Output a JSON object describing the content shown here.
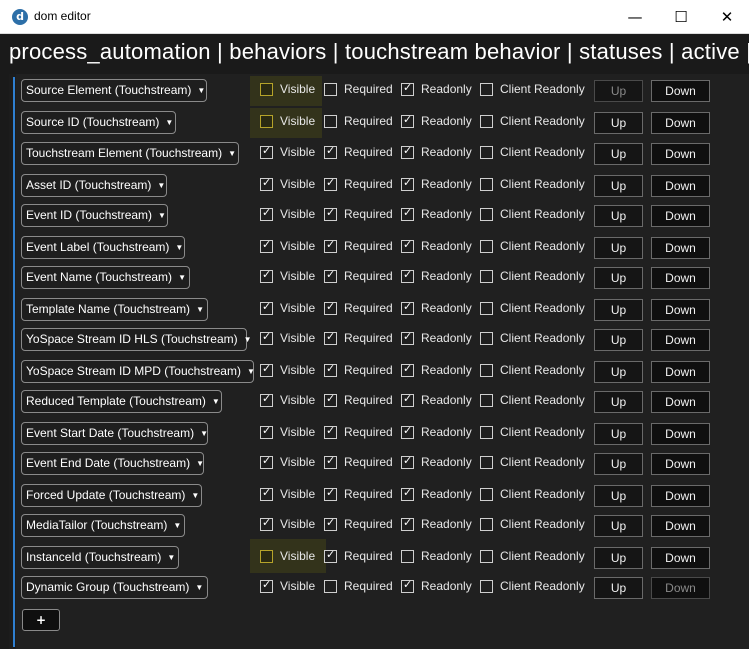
{
  "window": {
    "icon_letter": "d",
    "title": "dom editor",
    "minimize": "—",
    "maximize": "☐",
    "close": "✕"
  },
  "breadcrumb": "process_automation | behaviors | touchstream behavior | statuses | active | sec",
  "labels": {
    "visible": "Visible",
    "required": "Required",
    "readonly": "Readonly",
    "client_readonly": "Client Readonly",
    "up": "Up",
    "down": "Down",
    "add": "+"
  },
  "rows": [
    {
      "field": "Source Element (Touchstream)",
      "visible": false,
      "required": false,
      "readonly": true,
      "client_readonly": false,
      "highlight": true,
      "up_disabled": true,
      "down_disabled": false
    },
    {
      "field": "Source ID (Touchstream)",
      "visible": false,
      "required": false,
      "readonly": true,
      "client_readonly": false,
      "highlight": true,
      "up_disabled": false,
      "down_disabled": false
    },
    {
      "field": "Touchstream Element (Touchstream)",
      "visible": true,
      "required": true,
      "readonly": true,
      "client_readonly": false,
      "highlight": false,
      "up_disabled": false,
      "down_disabled": false
    },
    {
      "field": "Asset ID (Touchstream)",
      "visible": true,
      "required": true,
      "readonly": true,
      "client_readonly": false,
      "highlight": false,
      "up_disabled": false,
      "down_disabled": false
    },
    {
      "field": "Event ID (Touchstream)",
      "visible": true,
      "required": true,
      "readonly": true,
      "client_readonly": false,
      "highlight": false,
      "up_disabled": false,
      "down_disabled": false
    },
    {
      "field": "Event Label (Touchstream)",
      "visible": true,
      "required": true,
      "readonly": true,
      "client_readonly": false,
      "highlight": false,
      "up_disabled": false,
      "down_disabled": false
    },
    {
      "field": "Event Name (Touchstream)",
      "visible": true,
      "required": true,
      "readonly": true,
      "client_readonly": false,
      "highlight": false,
      "up_disabled": false,
      "down_disabled": false
    },
    {
      "field": "Template Name (Touchstream)",
      "visible": true,
      "required": true,
      "readonly": true,
      "client_readonly": false,
      "highlight": false,
      "up_disabled": false,
      "down_disabled": false
    },
    {
      "field": "YoSpace Stream ID HLS (Touchstream)",
      "visible": true,
      "required": true,
      "readonly": true,
      "client_readonly": false,
      "highlight": false,
      "up_disabled": false,
      "down_disabled": false
    },
    {
      "field": "YoSpace Stream ID MPD (Touchstream)",
      "visible": true,
      "required": true,
      "readonly": true,
      "client_readonly": false,
      "highlight": false,
      "up_disabled": false,
      "down_disabled": false
    },
    {
      "field": "Reduced Template (Touchstream)",
      "visible": true,
      "required": true,
      "readonly": true,
      "client_readonly": false,
      "highlight": false,
      "up_disabled": false,
      "down_disabled": false
    },
    {
      "field": "Event Start Date (Touchstream)",
      "visible": true,
      "required": true,
      "readonly": true,
      "client_readonly": false,
      "highlight": false,
      "up_disabled": false,
      "down_disabled": false
    },
    {
      "field": "Event End Date (Touchstream)",
      "visible": true,
      "required": true,
      "readonly": true,
      "client_readonly": false,
      "highlight": false,
      "up_disabled": false,
      "down_disabled": false
    },
    {
      "field": "Forced Update (Touchstream)",
      "visible": true,
      "required": true,
      "readonly": true,
      "client_readonly": false,
      "highlight": false,
      "up_disabled": false,
      "down_disabled": false
    },
    {
      "field": "MediaTailor (Touchstream)",
      "visible": true,
      "required": true,
      "readonly": true,
      "client_readonly": false,
      "highlight": false,
      "up_disabled": false,
      "down_disabled": false
    },
    {
      "field": "InstanceId (Touchstream)",
      "visible": false,
      "required": true,
      "readonly": false,
      "client_readonly": false,
      "highlight": true,
      "up_disabled": false,
      "down_disabled": false
    },
    {
      "field": "Dynamic Group (Touchstream)",
      "visible": true,
      "required": false,
      "readonly": true,
      "client_readonly": false,
      "highlight": false,
      "up_disabled": false,
      "down_disabled": true
    }
  ]
}
